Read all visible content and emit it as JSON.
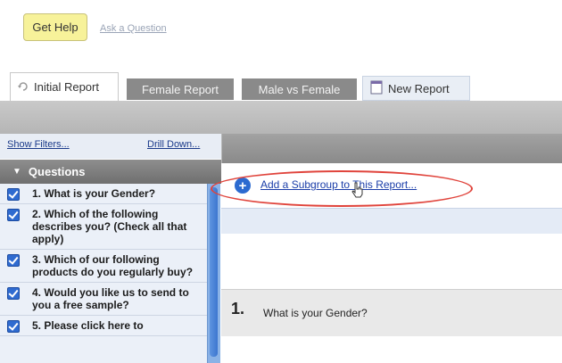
{
  "help": {
    "get_help_label": "Get Help",
    "ask_label": "Ask a Question"
  },
  "tabs": [
    {
      "label": "Initial Report",
      "active": true
    },
    {
      "label": "Female Report",
      "active": false
    },
    {
      "label": "Male vs Female",
      "active": false
    },
    {
      "label": "New Report",
      "active": false
    }
  ],
  "left_panel": {
    "show_filters": "Show Filters...",
    "drill_down": "Drill Down...",
    "questions_header": "Questions",
    "questions": [
      {
        "label": "1. What is your Gender?",
        "checked": true
      },
      {
        "label": "2. Which of the following describes you? (Check all that apply)",
        "checked": true
      },
      {
        "label": "3. Which of our following products do you regularly buy?",
        "checked": true
      },
      {
        "label": "4. Would you like us to send to you a free sample?",
        "checked": true
      },
      {
        "label": "5. Please click here to",
        "checked": true
      }
    ]
  },
  "main": {
    "add_subgroup_label": "Add a Subgroup to This Report...",
    "question_number": "1.",
    "question_title": "What is your Gender?"
  },
  "colors": {
    "accent_blue": "#2b6ad0",
    "highlight_red": "#e0443c",
    "help_yellow": "#f7f29a"
  }
}
